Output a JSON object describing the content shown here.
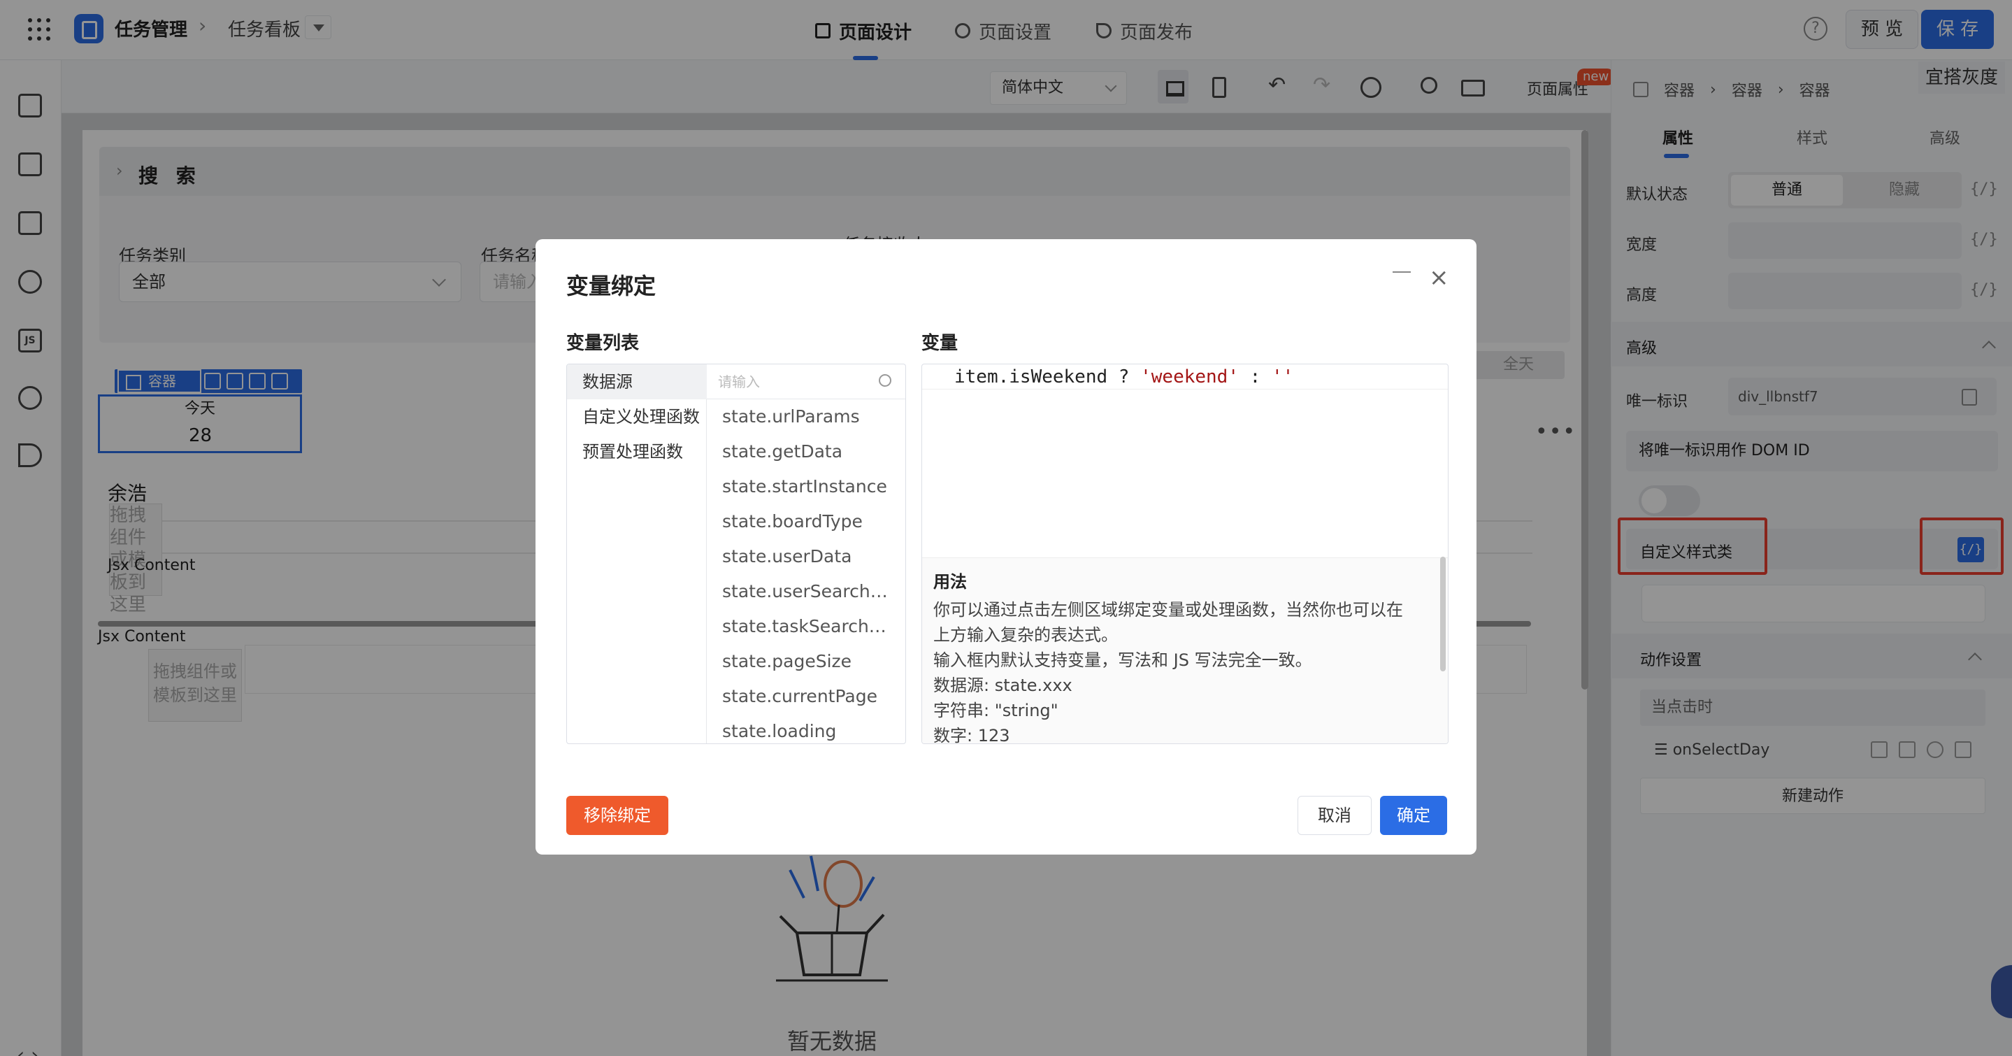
{
  "topbar": {
    "app_title": "任务管理",
    "breadcrumb_sep": "›",
    "page_name": "任务看板",
    "tabs": [
      {
        "label": "页面设计",
        "active": true
      },
      {
        "label": "页面设置",
        "active": false
      },
      {
        "label": "页面发布",
        "active": false
      }
    ],
    "help_icon": "?",
    "preview_label": "预 览",
    "save_label": "保 存",
    "gray_tip": "宜搭灰度"
  },
  "toolbar": {
    "language": "简体中文",
    "undo_icon": "↶",
    "redo_icon": "↷",
    "page_props_label": "页面属性",
    "new_badge": "new"
  },
  "canvas": {
    "search_title": "搜 索",
    "search_chevron": "›",
    "fields": [
      {
        "label": "任务类别"
      },
      {
        "label": "任务名称"
      },
      {
        "label": "任务接收人"
      }
    ],
    "category_value": "全部",
    "name_placeholder": "请输入",
    "allday_label": "全天",
    "component_label": "容器",
    "today_label": "今天",
    "today_number": "28",
    "more_icon": "•••",
    "person_name": "余浩",
    "drag_small": "拖拽组件或模板到这里",
    "jsx_content_1": "Jsx Content",
    "jsx_content_2": "Jsx Content",
    "drag_box": "拖拽组件或模板到这里",
    "empty_text": "暂无数据"
  },
  "rightpanel": {
    "breadcrumb": [
      "容器",
      "容器",
      "容器"
    ],
    "tabs": [
      "属性",
      "样式",
      "高级"
    ],
    "bind_symbol": "{/}",
    "default_state_label": "默认状态",
    "state_normal": "普通",
    "state_hidden": "隐藏",
    "width_label": "宽度",
    "height_label": "高度",
    "advanced_label": "高级",
    "uid_label": "唯一标识",
    "uid_value": "div_llbnstf7",
    "dom_id_label": "将唯一标识用作 DOM ID",
    "custom_class_label": "自定义样式类",
    "action_settings_label": "动作设置",
    "trigger_label": "当点击时",
    "action_name": "onSelectDay",
    "new_action_label": "新建动作"
  },
  "modal": {
    "title": "变量绑定",
    "close_icon": "×",
    "var_list_label": "变量列表",
    "variable_label": "变量",
    "categories": [
      "数据源",
      "自定义处理函数",
      "预置处理函数"
    ],
    "search_placeholder": "请输入",
    "variables": [
      "state.urlParams",
      "state.getData",
      "state.startInstance",
      "state.boardType",
      "state.userData",
      "state.userSearchList",
      "state.taskSearchList",
      "state.pageSize",
      "state.currentPage",
      "state.loading"
    ],
    "code_prefix": "item.isWeekend ? ",
    "code_str1": "'weekend'",
    "code_mid": " : ",
    "code_str2": "''",
    "usage_title": "用法",
    "usage_lines": [
      "你可以通过点击左侧区域绑定变量或处理函数，当然你也可以在",
      "上方输入复杂的表达式。",
      "输入框内默认支持变量，写法和 JS 写法完全一致。",
      "数据源: state.xxx",
      "字符串: \"string\"",
      "数字: 123"
    ],
    "remove_label": "移除绑定",
    "cancel_label": "取消",
    "ok_label": "确定"
  },
  "colors": {
    "primary": "#2b6de5",
    "danger": "#ef5a2c",
    "highlight_red": "#ec3e30"
  }
}
